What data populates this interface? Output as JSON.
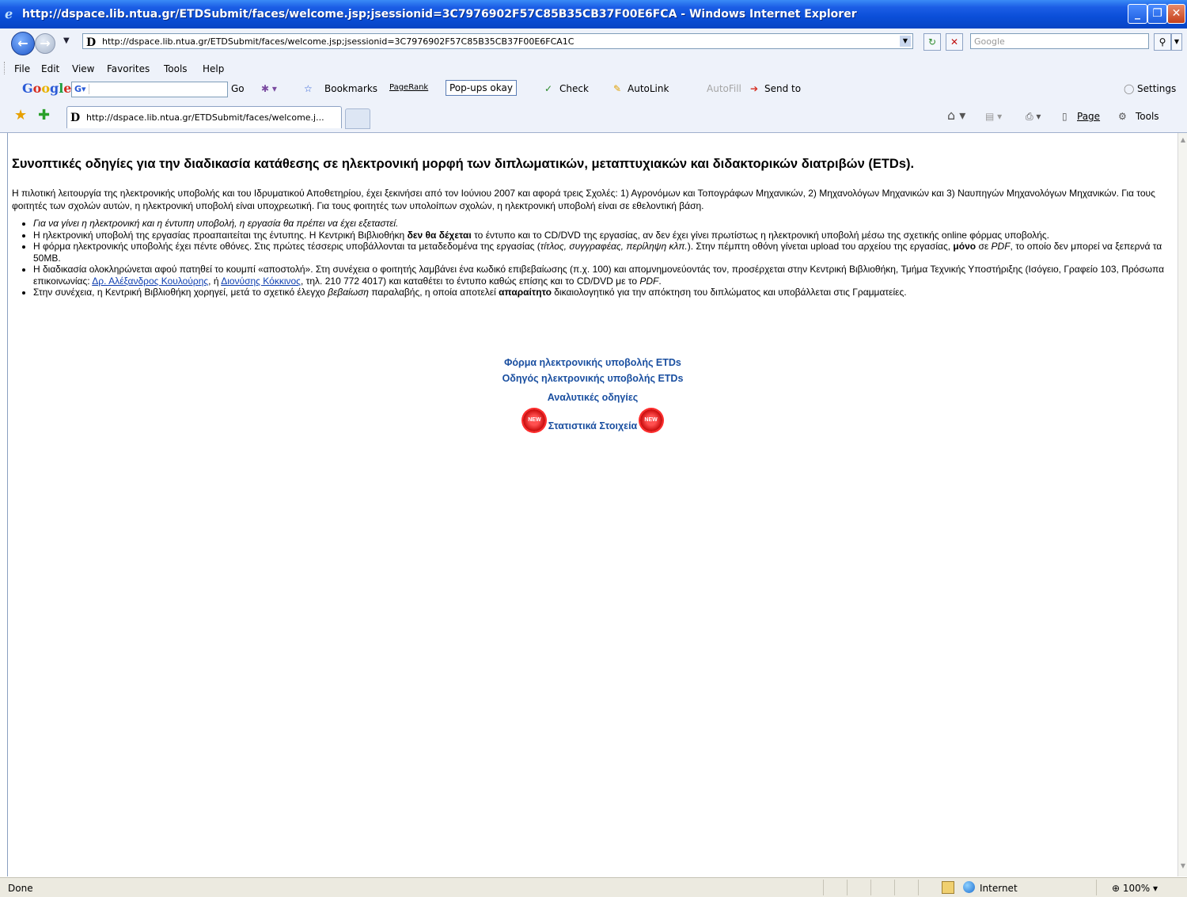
{
  "window": {
    "title": "http://dspace.lib.ntua.gr/ETDSubmit/faces/welcome.jsp;jsessionid=3C7976902F57C85B35CB37F00E6FCA - Windows Internet Explorer"
  },
  "address": {
    "url": "http://dspace.lib.ntua.gr/ETDSubmit/faces/welcome.jsp;jsessionid=3C7976902F57C85B35CB37F00E6FCA1C",
    "search_placeholder": "Google"
  },
  "menu": [
    "File",
    "Edit",
    "View",
    "Favorites",
    "Tools",
    "Help"
  ],
  "google_toolbar": {
    "logo": "Google",
    "go": "Go",
    "bookmarks": "Bookmarks",
    "pagerank": "PageRank",
    "popups": "Pop-ups okay",
    "check": "Check",
    "autolink": "AutoLink",
    "autofill": "AutoFill",
    "sendto": "Send to",
    "settings": "Settings"
  },
  "tabs": {
    "active_label": "http://dspace.lib.ntua.gr/ETDSubmit/faces/welcome.j...",
    "page": "Page",
    "tools": "Tools"
  },
  "content": {
    "heading": "Συνοπτικές οδηγίες για την διαδικασία κατάθεσης σε ηλεκτρονική μορφή των διπλωματικών, μεταπτυχιακών και διδακτορικών διατριβών (ETDs).",
    "intro": "Η πιλοτική λειτουργία της ηλεκτρονικής υποβολής και του Ιδρυματικού Αποθετηρίου, έχει ξεκινήσει από τον Ιούνιου 2007 και αφορά τρεις Σχολές: 1) Αγρονόμων και Τοπογράφων Μηχανικών, 2) Μηχανολόγων Μηχανικών και 3) Ναυπηγών Μηχανολόγων Μηχανικών. Για τους φοιτητές των σχολών αυτών, η ηλεκτρονική υποβολή είναι υποχρεωτική. Για τους φοιτητές των υπολοίπων σχολών, η ηλεκτρονική υποβολή είναι σε εθελοντική βάση.",
    "bullet1": "Για να γίνει η ηλεκτρονική και η έντυπη υποβολή, η εργασία θα πρέπει να έχει εξεταστεί.",
    "bullet2_a": "Η ηλεκτρονική υποβολή της εργασίας προαπαιτείται της έντυπης. Η Κεντρική Βιβλιοθήκη ",
    "bullet2_b": "δεν θα δέχεται",
    "bullet2_c": " το έντυπο και το CD/DVD της εργασίας, αν δεν έχει γίνει πρωτίστως η ηλεκτρονική υποβολή μέσω της σχετικής online φόρμας υποβολής.",
    "bullet3_a": "Η φόρμα ηλεκτρονικής υποβολής έχει πέντε οθόνες. Στις πρώτες τέσσερις υποβάλλονται τα μεταδεδομένα της εργασίας (",
    "bullet3_b": "τίτλος, συγγραφέας, περίληψη κλπ.",
    "bullet3_c": "). Στην πέμπτη οθόνη γίνεται upload του αρχείου της εργασίας, ",
    "bullet3_d": "μόνο",
    "bullet3_e": " σε ",
    "bullet3_f": "PDF",
    "bullet3_g": ", το οποίο δεν μπορεί να ξεπερνά τα 50MB.",
    "bullet4_a": "Η διαδικασία ολοκληρώνεται αφού πατηθεί το κουμπί «αποστολή». Στη συνέχεια ο φοιτητής λαμβάνει ένα κωδικό επιβεβαίωσης (π.χ. 100) και απομνημονεύοντάς τον, προσέρχεται στην Κεντρική Βιβλιοθήκη, Τμήμα Τεχνικής Υποστήριξης (Ισόγειο, Γραφείο 103, Πρόσωπα επικοινωνίας: ",
    "bullet4_link1": "Δρ. Αλέξανδρος Κουλούρης",
    "bullet4_b": ", ή ",
    "bullet4_link2": "Διονύσης Κόκκινος",
    "bullet4_c": ", τηλ. 210 772 4017) και καταθέτει το έντυπο καθώς επίσης και το CD/DVD με το ",
    "bullet4_d": "PDF",
    "bullet4_e": ".",
    "bullet5_a": "Στην συνέχεια, η Κεντρική Βιβλιοθήκη χορηγεί, μετά το σχετικό έλεγχο ",
    "bullet5_b": "βεβαίωση",
    "bullet5_c": " παραλαβής, η οποία αποτελεί ",
    "bullet5_d": "απαραίτητο",
    "bullet5_e": " δικαιολογητικό για την απόκτηση του διπλώματος και υποβάλλεται στις Γραμματείες.",
    "link_form": "Φόρμα ηλεκτρονικής υποβολής ETDs",
    "link_guide": "Οδηγός ηλεκτρονικής υποβολής ETDs",
    "link_detailed": "Αναλυτικές οδηγίες",
    "link_stats": "Στατιστικά Στοιχεία",
    "badge_text": "NEW"
  },
  "status": {
    "done": "Done",
    "zone": "Internet",
    "zoom": "100%"
  },
  "colors": {
    "titlebar": "#0a4ed8",
    "link": "#1a4fa0",
    "chrome": "#eef2fa"
  }
}
